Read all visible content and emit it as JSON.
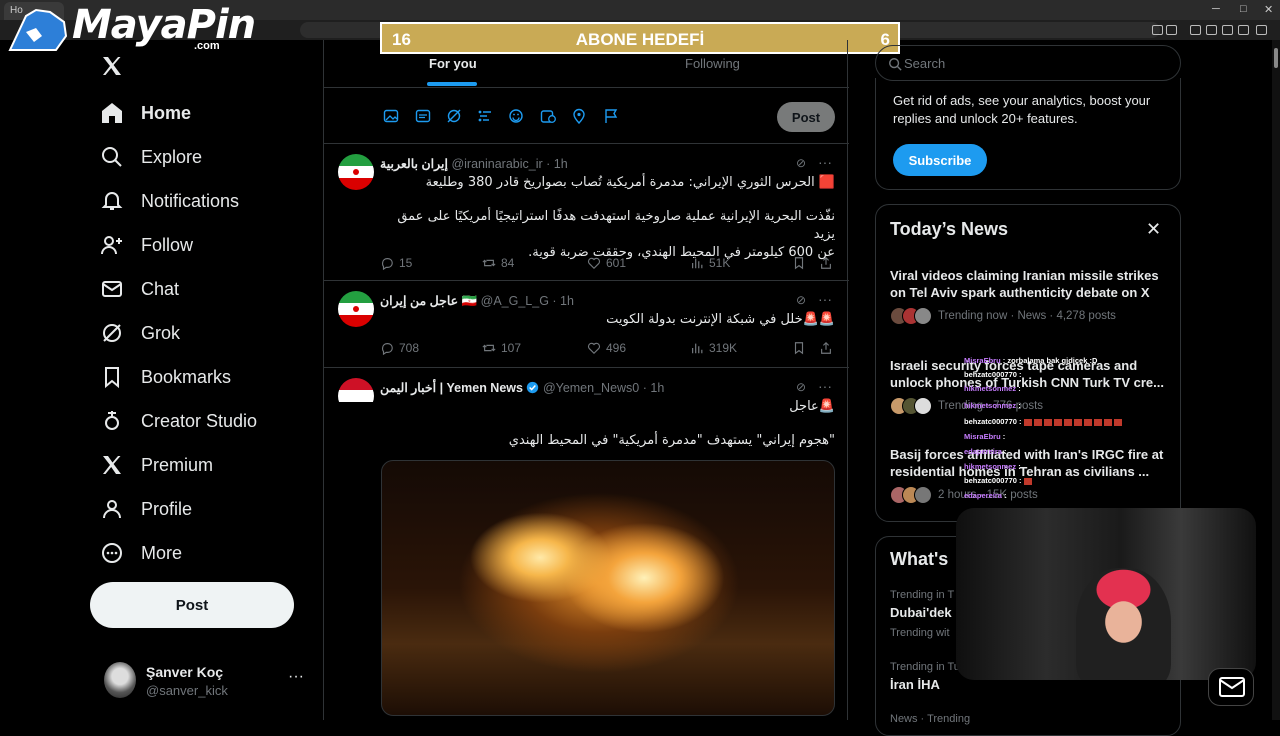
{
  "browser": {
    "tab_title": "Ho",
    "min": "─",
    "max": "□",
    "close": "✕"
  },
  "overlay": {
    "brand": "MayaPin",
    "brand_domain": ".com",
    "goal_left": "16",
    "goal_label": "ABONE HEDEFİ",
    "goal_right": "6"
  },
  "nav": {
    "items": [
      {
        "label": "Home",
        "icon": "home-icon"
      },
      {
        "label": "Explore",
        "icon": "search-icon"
      },
      {
        "label": "Notifications",
        "icon": "bell-icon"
      },
      {
        "label": "Follow",
        "icon": "follow-icon"
      },
      {
        "label": "Chat",
        "icon": "mail-icon"
      },
      {
        "label": "Grok",
        "icon": "grok-icon"
      },
      {
        "label": "Bookmarks",
        "icon": "bookmark-icon"
      },
      {
        "label": "Creator Studio",
        "icon": "creator-studio-icon"
      },
      {
        "label": "Premium",
        "icon": "x-logo-icon"
      },
      {
        "label": "Profile",
        "icon": "person-icon"
      },
      {
        "label": "More",
        "icon": "more-circle-icon"
      }
    ],
    "post_button": "Post"
  },
  "profile": {
    "name": "Şanver Koç",
    "handle": "@sanver_kick",
    "more": "···"
  },
  "feed": {
    "tabs": {
      "for_you": "For you",
      "following": "Following"
    },
    "composer_post": "Post",
    "tweets": [
      {
        "name": "إيران بالعربية",
        "handle": "@iraninarabic_ir",
        "time": "· 1h",
        "lines": [
          "🟥 الحرس الثوري الإيراني: مدمرة أمريكية تُصاب بصواريخ قادر 380 وطليعة",
          "",
          "نفّذت البحرية الإيرانية عملية صاروخية استهدفت هدفًا استراتيجيًا أمريكيًا على عمق يزيد",
          "عن 600 كيلومتر في المحيط الهندي، وحققت ضربة قوية."
        ],
        "replies": "15",
        "reposts": "84",
        "likes": "601",
        "views": "51K"
      },
      {
        "name": "عاجل من إيران 🇮🇷",
        "handle": "@A_G_L_G",
        "time": "· 1h",
        "lines": [
          "🚨🚨خلل في شبكة الإنترنت بدولة الكويت"
        ],
        "replies": "708",
        "reposts": "107",
        "likes": "496",
        "views": "319K"
      },
      {
        "name": "أخبار اليمن | Yemen News",
        "handle": "@Yemen_News0",
        "time": "· 1h",
        "lines": [
          "🚨عاجل",
          "",
          "\"هجوم إيراني\" يستهدف \"مدمرة أمريكية\" في المحيط الهندي"
        ]
      }
    ],
    "grok_glyph": "⊘",
    "more_glyph": "···"
  },
  "right": {
    "search_placeholder": "Search",
    "premium_text": "Get rid of ads, see your analytics, boost your replies and unlock 20+ features.",
    "subscribe": "Subscribe",
    "news_title": "Today’s News",
    "news_close": "✕",
    "news": [
      {
        "headline": "Viral videos claiming Iranian missile strikes on Tel Aviv spark authenticity debate on X",
        "meta": "Trending now · News · 4,278 posts"
      },
      {
        "headline": "Israeli security forces tape cameras and unlock phones of Turkish CNN Turk TV cre...",
        "meta": "Trending · 776 posts"
      },
      {
        "headline": "Basij forces affiliated with Iran's IRGC fire at residential homes in Tehran as civilians ...",
        "meta": "2 hours · 15K posts"
      }
    ],
    "whats_title": "What's",
    "trends": [
      {
        "context": "Trending in T",
        "name": "Dubai'dek",
        "sub": "Trending wit"
      },
      {
        "context": "Trending in Tu",
        "name": "İran İHA"
      },
      {
        "context": "News · Trending"
      }
    ]
  },
  "chat": {
    "rows": [
      {
        "user": "MisraEbru",
        "msg": "zorbalama bak gidicek :D"
      },
      {
        "user": "behzatc000770",
        "msg": ""
      },
      {
        "user": "hikmetsonmez",
        "msg": ""
      },
      {
        "user": "hikmetsonmez",
        "msg": ""
      },
      {
        "user": "behzatc000770",
        "msg": ""
      },
      {
        "user": "MisraEbru",
        "msg": ""
      },
      {
        "user": "edapereira",
        "msg": ""
      },
      {
        "user": "hikmetsonmez",
        "msg": ""
      },
      {
        "user": "behzatc000770",
        "msg": ""
      },
      {
        "user": "edapereira",
        "msg": ""
      }
    ]
  },
  "colors": {
    "accent": "#1d9bf0",
    "goal_bar": "#c9aa55",
    "background": "#000000",
    "muted": "#71767b"
  }
}
